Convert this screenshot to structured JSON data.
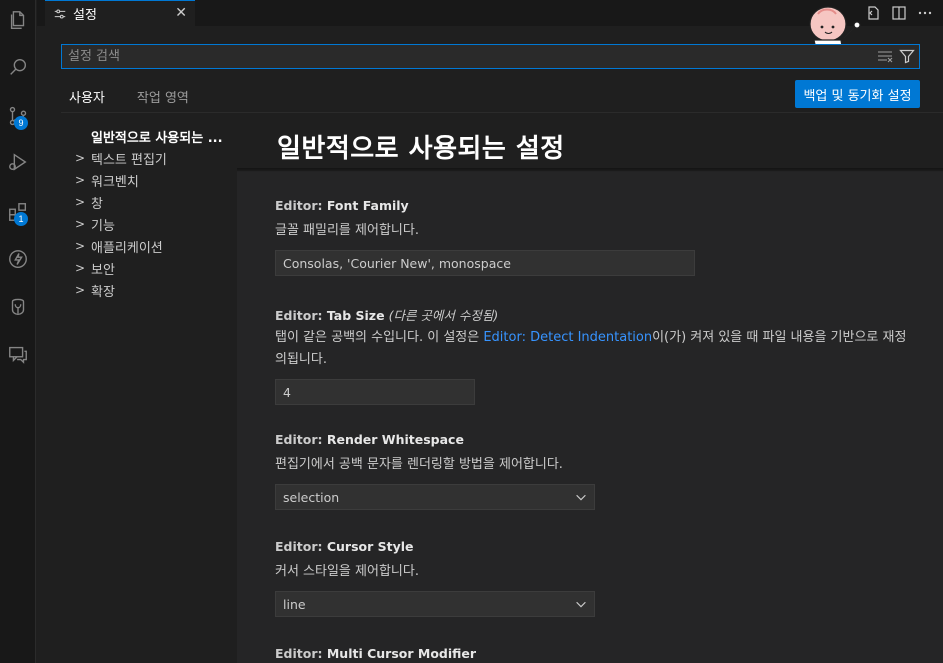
{
  "editor_tab": {
    "label": "설정",
    "close": "✕"
  },
  "search": {
    "placeholder": "설정 검색",
    "value": ""
  },
  "scope_tabs": [
    {
      "label": "사용자",
      "active": true
    },
    {
      "label": "작업 영역",
      "active": false
    }
  ],
  "sync_button": "백업 및 동기화 설정",
  "activity_bar": {
    "items": [
      {
        "icon": "files-icon"
      },
      {
        "icon": "search-icon"
      },
      {
        "icon": "source-control-icon",
        "badge": "9"
      },
      {
        "icon": "run-debug-icon"
      },
      {
        "icon": "extensions-icon",
        "badge": "1"
      },
      {
        "icon": "lightning-icon"
      },
      {
        "icon": "database-icon"
      },
      {
        "icon": "comments-icon"
      }
    ]
  },
  "toc": {
    "active": "일반적으로 사용되는 ...",
    "items": [
      "텍스트 편집기",
      "워크벤치",
      "창",
      "기능",
      "애플리케이션",
      "보안",
      "확장"
    ]
  },
  "section_title": "일반적으로 사용되는 설정",
  "settings": [
    {
      "category": "Editor: ",
      "key": "Font Family",
      "description": "글꼴 패밀리를 제어합니다.",
      "value": "Consolas, 'Courier New', monospace"
    },
    {
      "category": "Editor: ",
      "key": "Tab Size",
      "modified": "(다른 곳에서 수정됨)",
      "description_pre": "탭이 같은 공백의 수입니다. 이 설정은 ",
      "description_link": "Editor: Detect Indentation",
      "description_post": "이(가) 켜져 있을 때 파일 내용을 기반으로 재정의됩니다.",
      "value": "4"
    },
    {
      "category": "Editor: ",
      "key": "Render Whitespace",
      "description": "편집기에서 공백 문자를 렌더링할 방법을 제어합니다.",
      "value": "selection"
    },
    {
      "category": "Editor: ",
      "key": "Cursor Style",
      "description": "커서 스타일을 제어합니다.",
      "value": "line"
    },
    {
      "category": "Editor: ",
      "key": "Multi Cursor Modifier"
    }
  ],
  "colors": {
    "accent": "#0078d4",
    "link": "#3794ff",
    "background": "#1f1f1f"
  }
}
